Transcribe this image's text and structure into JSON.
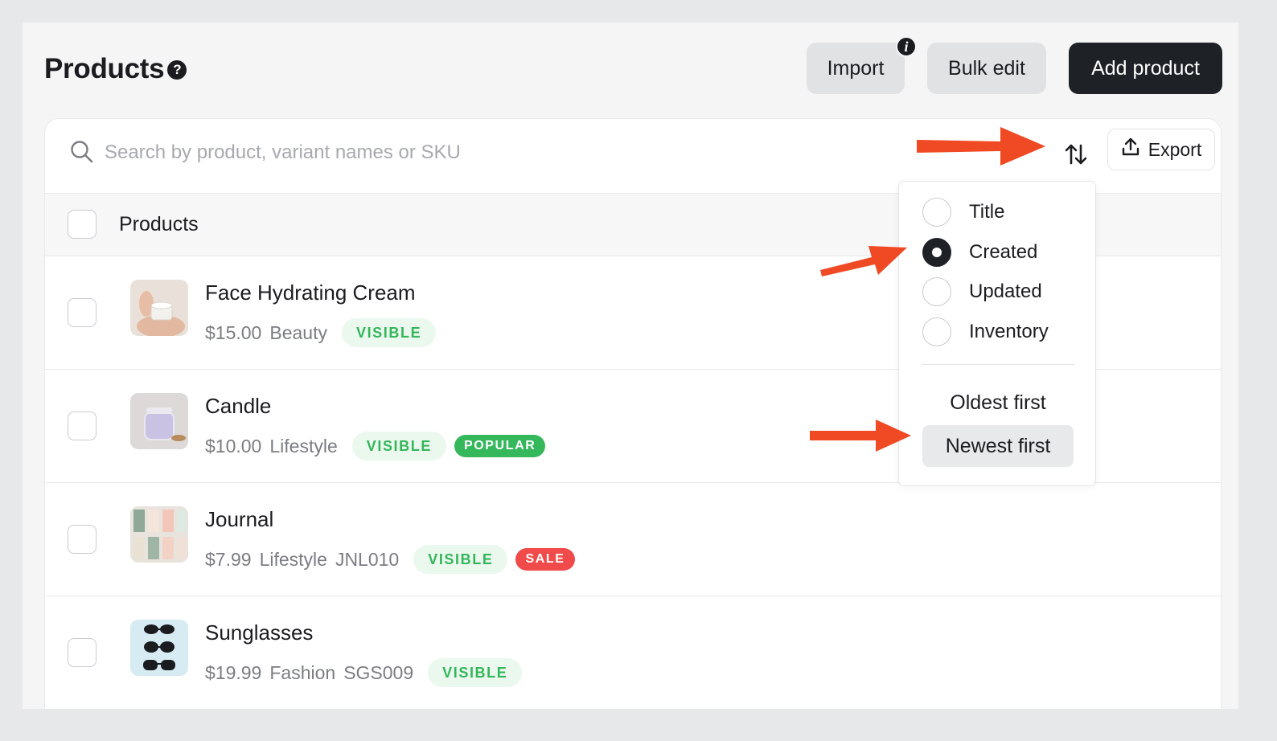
{
  "header": {
    "title": "Products",
    "import_label": "Import",
    "bulk_edit_label": "Bulk edit",
    "add_product_label": "Add product"
  },
  "search": {
    "placeholder": "Search by product, variant names or SKU",
    "export_label": "Export"
  },
  "table": {
    "column_label": "Products",
    "rows": [
      {
        "name": "Face Hydrating Cream",
        "price": "$15.00",
        "category": "Beauty",
        "sku": "",
        "tags": [
          "VISIBLE"
        ]
      },
      {
        "name": "Candle",
        "price": "$10.00",
        "category": "Lifestyle",
        "sku": "",
        "tags": [
          "VISIBLE",
          "POPULAR"
        ]
      },
      {
        "name": "Journal",
        "price": "$7.99",
        "category": "Lifestyle",
        "sku": "JNL010",
        "tags": [
          "VISIBLE",
          "SALE"
        ]
      },
      {
        "name": "Sunglasses",
        "price": "$19.99",
        "category": "Fashion",
        "sku": "SGS009",
        "tags": [
          "VISIBLE"
        ]
      }
    ]
  },
  "sort_menu": {
    "options": [
      "Title",
      "Created",
      "Updated",
      "Inventory"
    ],
    "selected": "Created",
    "order_options": [
      "Oldest first",
      "Newest first"
    ],
    "selected_order": "Newest first"
  },
  "colors": {
    "accent_dark": "#1e2226",
    "visible_tag": "#34b65a",
    "popular_tag": "#35b85c",
    "sale_tag": "#f04a4a",
    "annotation_arrow": "#f04a25"
  }
}
